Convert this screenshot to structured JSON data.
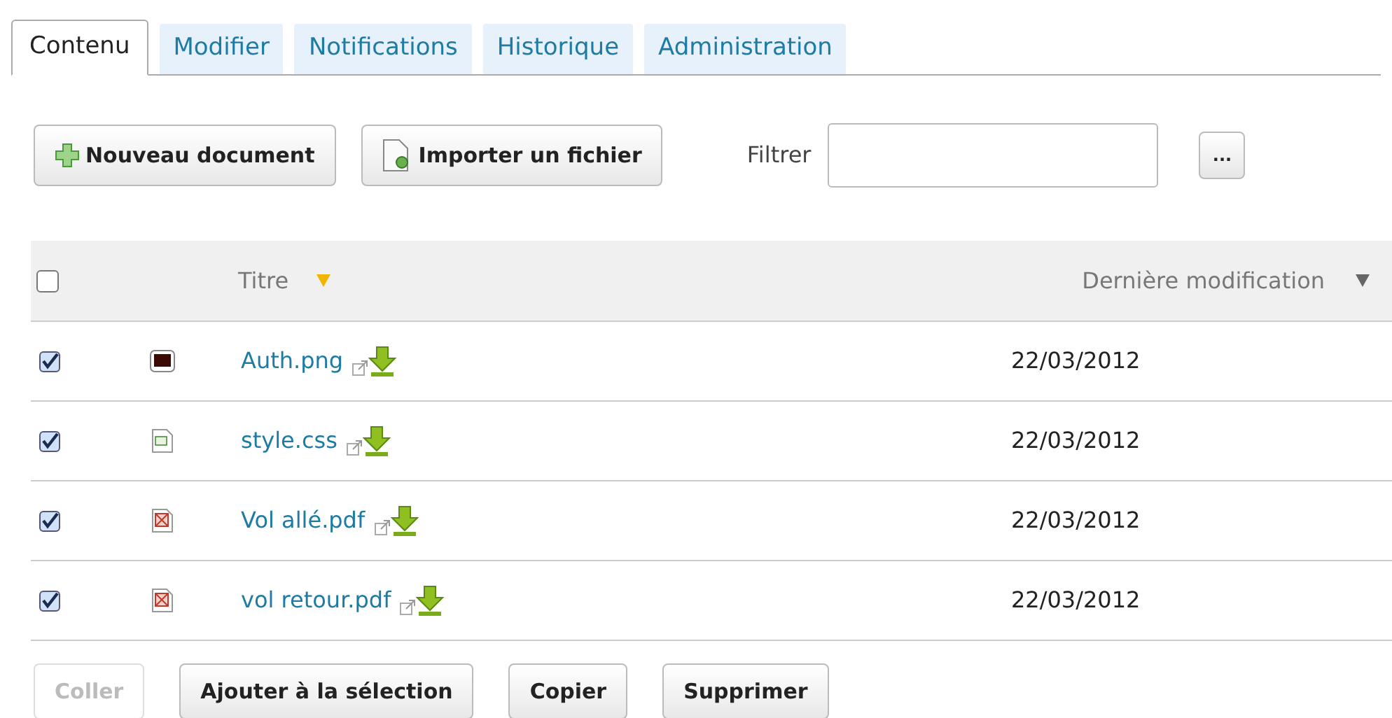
{
  "tabs": [
    {
      "label": "Contenu",
      "selected": true
    },
    {
      "label": "Modifier",
      "selected": false
    },
    {
      "label": "Notifications",
      "selected": false
    },
    {
      "label": "Historique",
      "selected": false
    },
    {
      "label": "Administration",
      "selected": false
    }
  ],
  "toolbar": {
    "buttons": [
      {
        "label": "Nouveau document",
        "kind": "add"
      },
      {
        "label": "Importer un fichier",
        "kind": "import"
      }
    ],
    "filter": {
      "label": "Filtrer"
    },
    "more_button": "..."
  },
  "table": {
    "select_all": {
      "checked": false
    },
    "columns": [
      {
        "label": "Titre",
        "sorted": true
      },
      {
        "label": "Dernière modification",
        "sorted": false
      }
    ],
    "rows": [
      {
        "checked": true,
        "kind": "image",
        "title": "Auth.png",
        "modified": "22/03/2012"
      },
      {
        "checked": true,
        "kind": "code",
        "title": "style.css",
        "modified": "22/03/2012"
      },
      {
        "checked": true,
        "kind": "pdf",
        "title": "Vol allé.pdf",
        "modified": "22/03/2012"
      },
      {
        "checked": true,
        "kind": "pdf",
        "title": "vol retour.pdf",
        "modified": "22/03/2012"
      }
    ]
  },
  "actions": [
    {
      "label": "Coller",
      "disabled": true
    },
    {
      "label": "Ajouter à la sélection",
      "disabled": false
    },
    {
      "label": "Copier",
      "disabled": false
    },
    {
      "label": "Supprimer",
      "disabled": false
    }
  ]
}
